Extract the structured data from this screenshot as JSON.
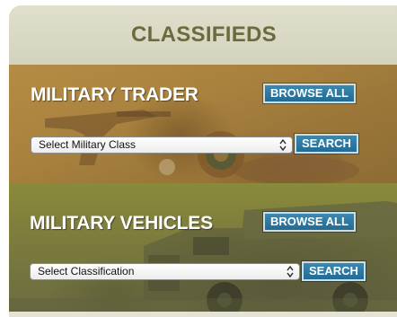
{
  "header": {
    "title": "CLASSIFIEDS"
  },
  "military_trader": {
    "title": "MILITARY TRADER",
    "browse_label": "BROWSE ALL",
    "select_value": "Select Military Class",
    "search_label": "SEARCH"
  },
  "military_vehicles": {
    "title": "MILITARY VEHICLES",
    "browse_label": "BROWSE ALL",
    "select_value": "Select Classification",
    "search_label": "SEARCH"
  },
  "colors": {
    "header_text": "#6d6a3e",
    "trader_panel": "#a8813e",
    "vehicles_panel": "#7a7a3e",
    "button": "#2f7ba3",
    "button_border": "#c9dfe8"
  },
  "icons": {
    "trader_art": "militaria-collage",
    "vehicles_art": "army-truck",
    "select_arrows": "updown-chevron-icon"
  }
}
